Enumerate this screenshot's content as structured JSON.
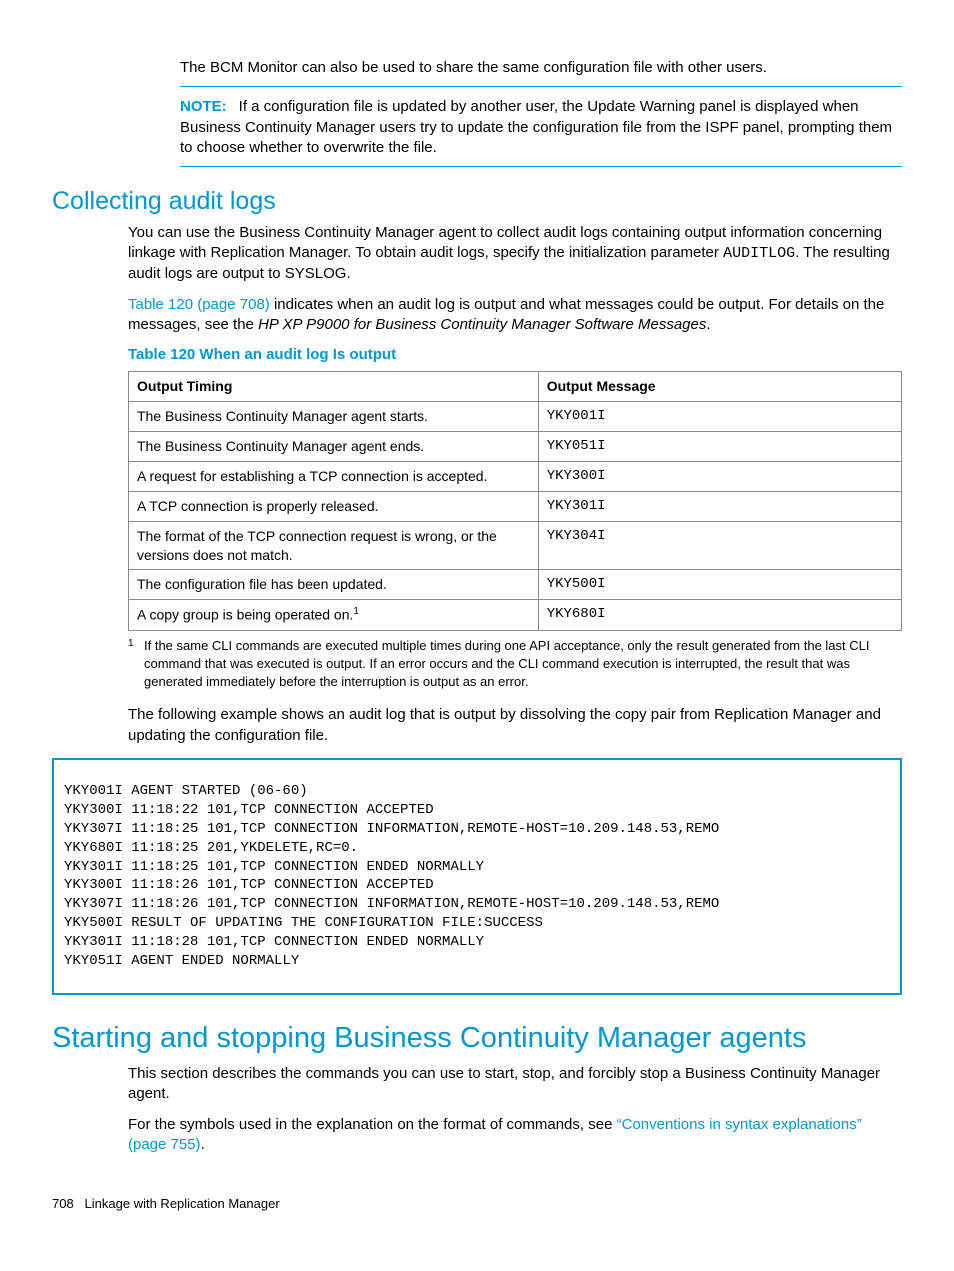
{
  "intro": "The BCM Monitor can also be used to share the same configuration file with other users.",
  "note": {
    "label": "NOTE:",
    "body": "If a configuration file is updated by another user, the Update Warning panel is displayed when Business Continuity Manager users try to update the configuration file from the ISPF panel, prompting them to choose whether to overwrite the file."
  },
  "section1": {
    "heading": "Collecting audit logs",
    "p1a": "You can use the Business Continuity Manager agent to collect audit logs containing output information concerning linkage with Replication Manager. To obtain audit logs, specify the initialization parameter ",
    "p1_code": "AUDITLOG",
    "p1b": ". The resulting audit logs are output to SYSLOG.",
    "p2_link": "Table 120 (page 708)",
    "p2a": " indicates when an audit log is output and what messages could be output. For details on the messages, see the ",
    "p2_ital": "HP XP P9000 for Business Continuity Manager Software Messages",
    "p2b": "."
  },
  "table": {
    "caption": "Table 120 When an audit log Is output",
    "head": {
      "c1": "Output Timing",
      "c2": "Output Message"
    },
    "rows": [
      {
        "timing": "The Business Continuity Manager agent starts.",
        "msg": "YKY001I",
        "fn": ""
      },
      {
        "timing": "The Business Continuity Manager agent ends.",
        "msg": "YKY051I",
        "fn": ""
      },
      {
        "timing": "A request for establishing a TCP connection is accepted.",
        "msg": "YKY300I",
        "fn": ""
      },
      {
        "timing": "A TCP connection is properly released.",
        "msg": "YKY301I",
        "fn": ""
      },
      {
        "timing": "The format of the TCP connection request is wrong, or the versions does not match.",
        "msg": "YKY304I",
        "fn": ""
      },
      {
        "timing": "The configuration file has been updated.",
        "msg": "YKY500I",
        "fn": ""
      },
      {
        "timing": "A copy group is being operated on.",
        "msg": "YKY680I",
        "fn": "1"
      }
    ]
  },
  "footnote": {
    "mark": "1",
    "text": "If the same CLI commands are executed multiple times during one API acceptance, only the result generated from the last CLI command that was executed is output. If an error occurs and the CLI command execution is interrupted, the result that was generated immediately before the interruption is output as an error."
  },
  "example_intro": "The following example shows an audit log that is output by dissolving the copy pair from Replication Manager and updating the configuration file.",
  "code": "YKY001I AGENT STARTED (06-60)\nYKY300I 11:18:22 101,TCP CONNECTION ACCEPTED\nYKY307I 11:18:25 101,TCP CONNECTION INFORMATION,REMOTE-HOST=10.209.148.53,REMO\nYKY680I 11:18:25 201,YKDELETE,RC=0.\nYKY301I 11:18:25 101,TCP CONNECTION ENDED NORMALLY\nYKY300I 11:18:26 101,TCP CONNECTION ACCEPTED\nYKY307I 11:18:26 101,TCP CONNECTION INFORMATION,REMOTE-HOST=10.209.148.53,REMO\nYKY500I RESULT OF UPDATING THE CONFIGURATION FILE:SUCCESS\nYKY301I 11:18:28 101,TCP CONNECTION ENDED NORMALLY\nYKY051I AGENT ENDED NORMALLY",
  "section2": {
    "heading": "Starting and stopping Business Continuity Manager agents",
    "p1": "This section describes the commands you can use to start, stop, and forcibly stop a Business Continuity Manager agent.",
    "p2a": "For the symbols used in the explanation on the format of commands, see ",
    "p2_link": "“Conventions in syntax explanations” (page 755)",
    "p2b": "."
  },
  "footer": {
    "page": "708",
    "chapter": "Linkage with Replication Manager"
  }
}
